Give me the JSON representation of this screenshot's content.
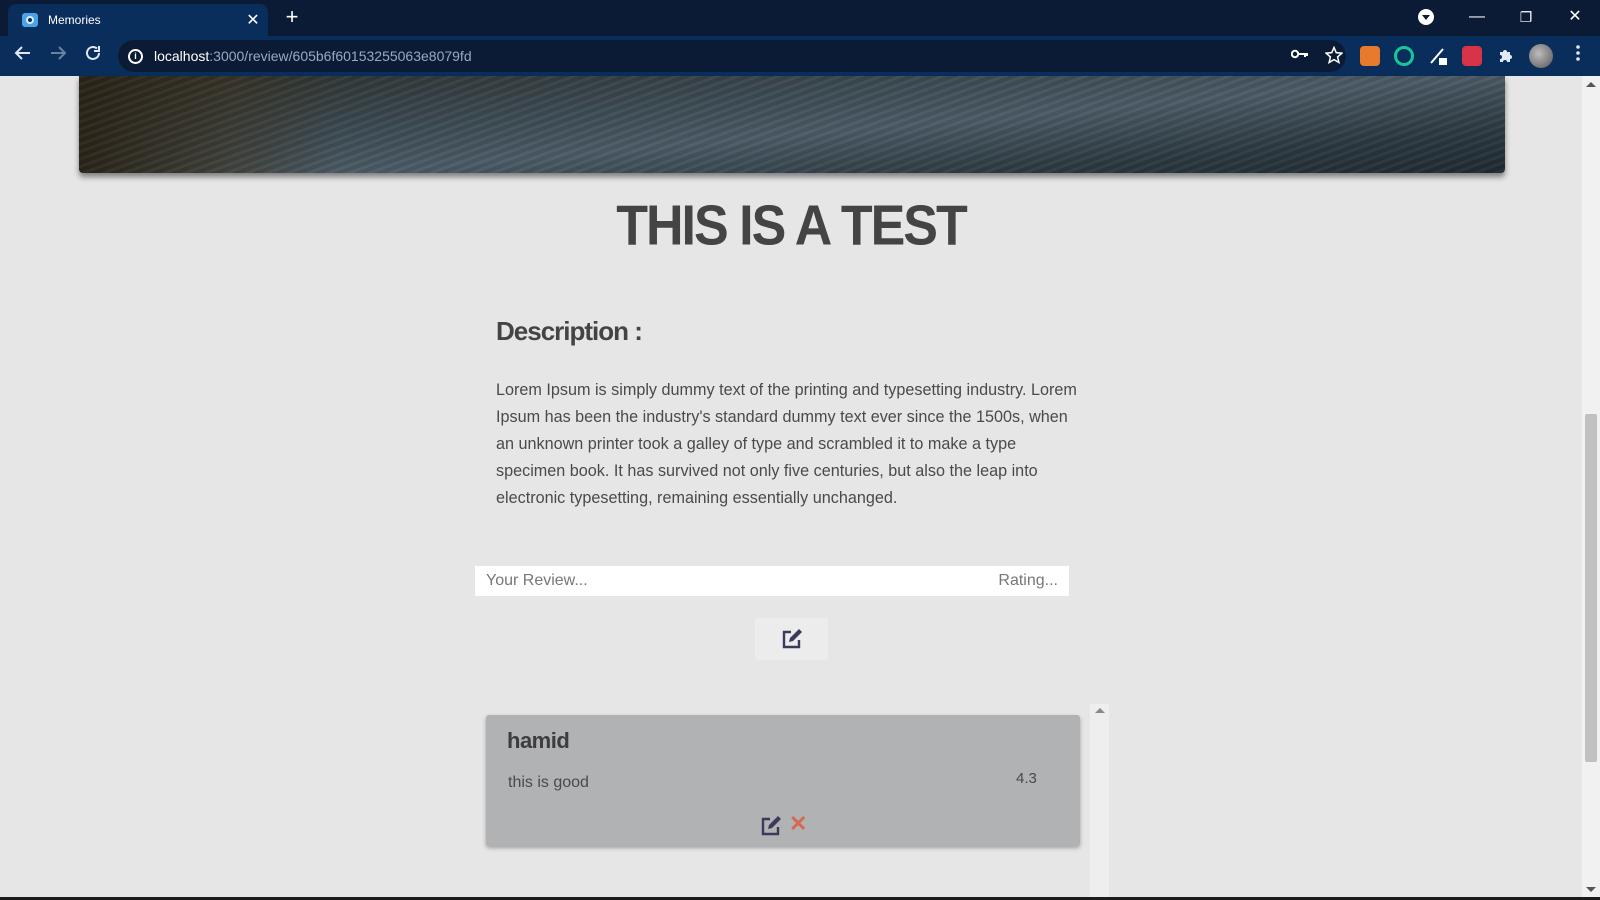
{
  "browser": {
    "tab_title": "Memories",
    "tab_close": "✕",
    "new_tab": "+",
    "url_host": "localhost",
    "url_rest": ":3000/review/605b6f60153255063e8079fd",
    "window_buttons": {
      "minimize": "—",
      "restore": "❐",
      "close": "✕"
    },
    "icons": [
      "back-icon",
      "forward-icon",
      "reload-icon",
      "info-icon",
      "key-icon",
      "star-icon",
      "extensions-icon",
      "menu-icon"
    ]
  },
  "page": {
    "title": "THIS IS A TEST",
    "description_heading": "Description :",
    "description": "Lorem Ipsum is simply dummy text of the printing and typesetting industry. Lorem Ipsum has been the industry's standard dummy text ever since the 1500s, when an unknown printer took a galley of type and scrambled it to make a type specimen book. It has survived not only five centuries, but also the leap into electronic typesetting, remaining essentially unchanged."
  },
  "review_form": {
    "review_placeholder": "Your Review...",
    "rating_placeholder": "Rating...",
    "submit_icon": "edit-icon"
  },
  "reviews": [
    {
      "author": "hamid",
      "text": "this is good",
      "rating": "4.3",
      "delete_glyph": "✕"
    }
  ],
  "colors": {
    "page_background": "#e6e6e6",
    "chrome_dark": "#0c1b35",
    "chrome_toolbar": "#0a2e5c",
    "review_card": "#b1b2b4",
    "edit_icon": "#3b3a5c",
    "delete_icon": "#d66a50"
  }
}
